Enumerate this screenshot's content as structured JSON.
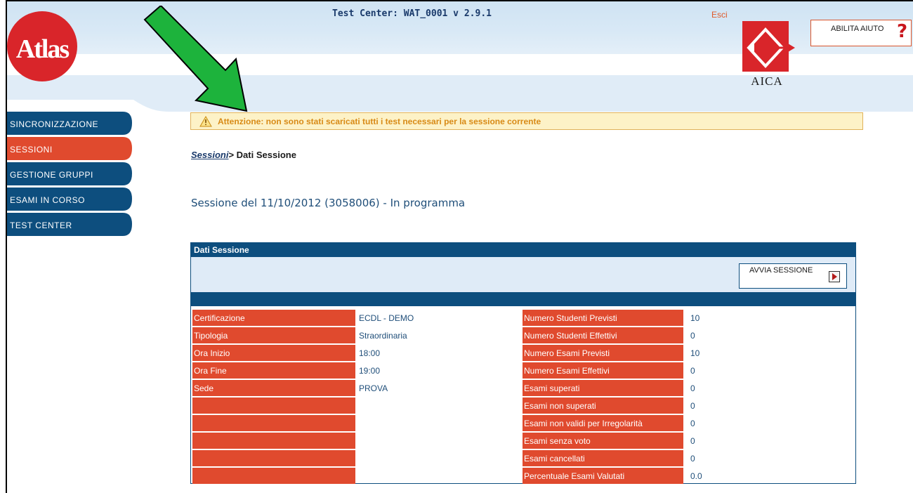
{
  "header": {
    "title": "Test Center: WAT_0001 v 2.9.1",
    "logout_label": "Esci",
    "help_label": "ABILITA AIUTO",
    "help_icon": "question-mark-icon",
    "logo_text": "Atlas",
    "partner_logo_text": "AICA"
  },
  "sidebar": {
    "items": [
      {
        "label": "SINCRONIZZAZIONE",
        "active": false
      },
      {
        "label": "SESSIONI",
        "active": true
      },
      {
        "label": "GESTIONE GRUPPI",
        "active": false
      },
      {
        "label": "ESAMI IN CORSO",
        "active": false
      },
      {
        "label": "TEST CENTER",
        "active": false
      }
    ]
  },
  "warning": {
    "icon": "warning-triangle-icon",
    "text": "Attenzione: non sono stati scaricati tutti i test necessari per la sessione corrente"
  },
  "breadcrumb": {
    "link": "Sessioni",
    "current": "> Dati Sessione"
  },
  "session_title": "Sessione del 11/10/2012 (3058006) - In programma",
  "panel": {
    "title": "Dati Sessione",
    "start_button": "AVVIA SESSIONE",
    "start_icon": "play-icon",
    "left_rows": [
      {
        "label": "Certificazione",
        "value": "ECDL - DEMO"
      },
      {
        "label": "Tipologia",
        "value": "Straordinaria"
      },
      {
        "label": "Ora Inizio",
        "value": "18:00"
      },
      {
        "label": "Ora Fine",
        "value": "19:00"
      },
      {
        "label": "Sede",
        "value": "PROVA"
      },
      {
        "label": "",
        "value": ""
      },
      {
        "label": "",
        "value": ""
      },
      {
        "label": "",
        "value": ""
      },
      {
        "label": "",
        "value": ""
      },
      {
        "label": "",
        "value": ""
      }
    ],
    "right_rows": [
      {
        "label": "Numero Studenti Previsti",
        "value": "10"
      },
      {
        "label": "Numero Studenti Effettivi",
        "value": "0"
      },
      {
        "label": "Numero Esami Previsti",
        "value": "10"
      },
      {
        "label": "Numero Esami Effettivi",
        "value": "0"
      },
      {
        "label": "Esami superati",
        "value": "0"
      },
      {
        "label": "Esami non superati",
        "value": "0"
      },
      {
        "label": "Esami non validi per Irregolarità",
        "value": "0"
      },
      {
        "label": "Esami senza voto",
        "value": "0"
      },
      {
        "label": "Esami cancellati",
        "value": "0"
      },
      {
        "label": "Percentuale Esami Valutati",
        "value": "0.0"
      }
    ]
  },
  "colors": {
    "nav_blue": "#0d4e7e",
    "nav_active": "#e04a2e",
    "accent_red": "#e04a2e",
    "warning_bg": "#fdf2c7",
    "annotation_arrow": "#1db33c"
  }
}
